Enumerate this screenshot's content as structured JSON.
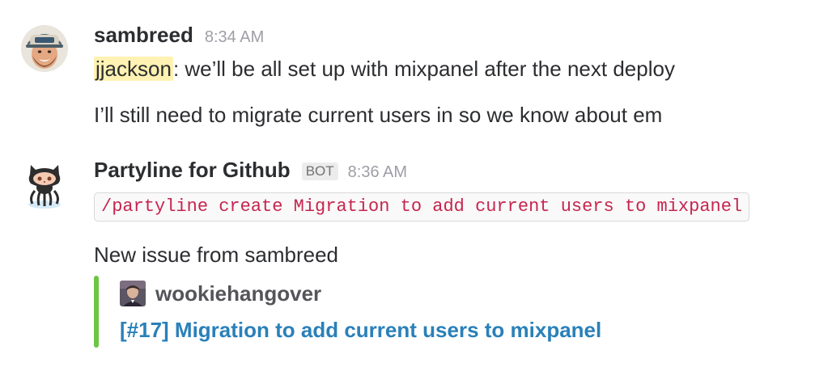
{
  "messages": [
    {
      "sender": "sambreed",
      "time": "8:34 AM",
      "avatar_icon": "user-avatar-hat-beard",
      "lines": [
        {
          "mention": "jjackson",
          "text": ": we’ll be all set up with mixpanel after the next deploy"
        },
        {
          "text": "I’ll still need to migrate current users in so we know about em"
        }
      ]
    },
    {
      "sender": "Partyline for Github",
      "badge": "BOT",
      "time": "8:36 AM",
      "avatar_icon": "github-octocat-icon",
      "command": "/partyline create Migration to add current users to mixpanel",
      "text": "New issue from sambreed",
      "attachment": {
        "author": "wookiehangover",
        "author_icon": "user-avatar-small",
        "title": "[#17] Migration to add current users to mixpanel",
        "bar_color": "#6cc644",
        "link_color": "#2a80b9"
      }
    }
  ],
  "colors": {
    "mention_bg": "#fff2b2",
    "code_text": "#c7254e",
    "timestamp": "#9e9ea6"
  }
}
